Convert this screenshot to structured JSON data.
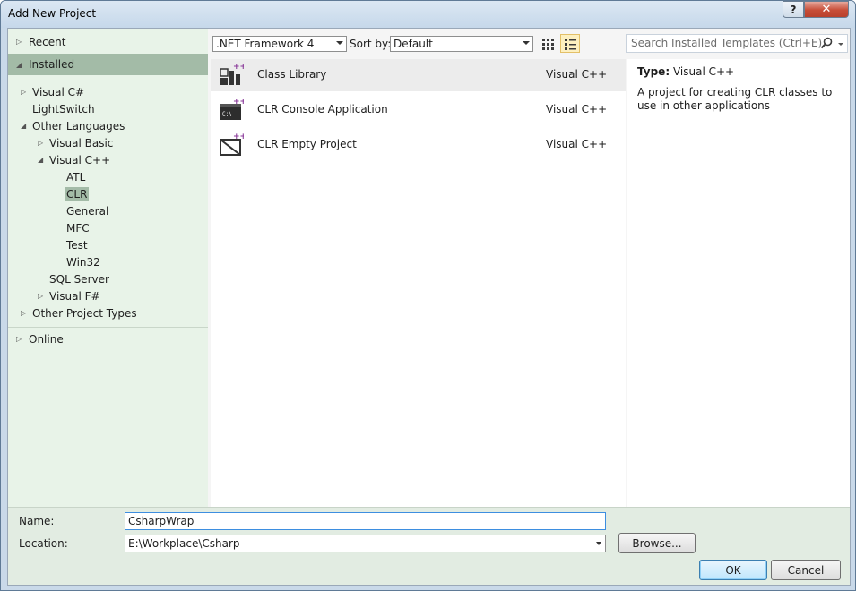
{
  "window": {
    "title": "Add New Project",
    "help_label": "?",
    "close_label": "✕"
  },
  "nav": {
    "recent": "Recent",
    "installed": "Installed",
    "tree": {
      "visual_csharp": "Visual C#",
      "lightswitch": "LightSwitch",
      "other_languages": "Other Languages",
      "visual_basic": "Visual Basic",
      "visual_cpp": "Visual C++",
      "atl": "ATL",
      "clr": "CLR",
      "general": "General",
      "mfc": "MFC",
      "test": "Test",
      "win32": "Win32",
      "sql_server": "SQL Server",
      "visual_fsharp": "Visual F#",
      "other_project_types": "Other Project Types"
    },
    "online": "Online"
  },
  "toolbar": {
    "framework": ".NET Framework 4",
    "sort_by_label": "Sort by:",
    "sort_value": "Default"
  },
  "search": {
    "placeholder": "Search Installed Templates (Ctrl+E)"
  },
  "templates": [
    {
      "name": "Class Library",
      "language": "Visual C++",
      "icon": "class-library-icon"
    },
    {
      "name": "CLR Console Application",
      "language": "Visual C++",
      "icon": "console-app-icon"
    },
    {
      "name": "CLR Empty Project",
      "language": "Visual C++",
      "icon": "empty-project-icon"
    }
  ],
  "description": {
    "type_label": "Type:",
    "type_value": "Visual C++",
    "text": "A project for creating CLR classes to use in other applications"
  },
  "form": {
    "name_label": "Name:",
    "name_value": "CsharpWrap",
    "location_label": "Location:",
    "location_value": "E:\\Workplace\\Csharp",
    "browse_label": "Browse...",
    "ok_label": "OK",
    "cancel_label": "Cancel"
  },
  "colors": {
    "selection_green": "#a3bba7",
    "nav_background": "#e8f3e8",
    "selected_template": "#ececec"
  }
}
